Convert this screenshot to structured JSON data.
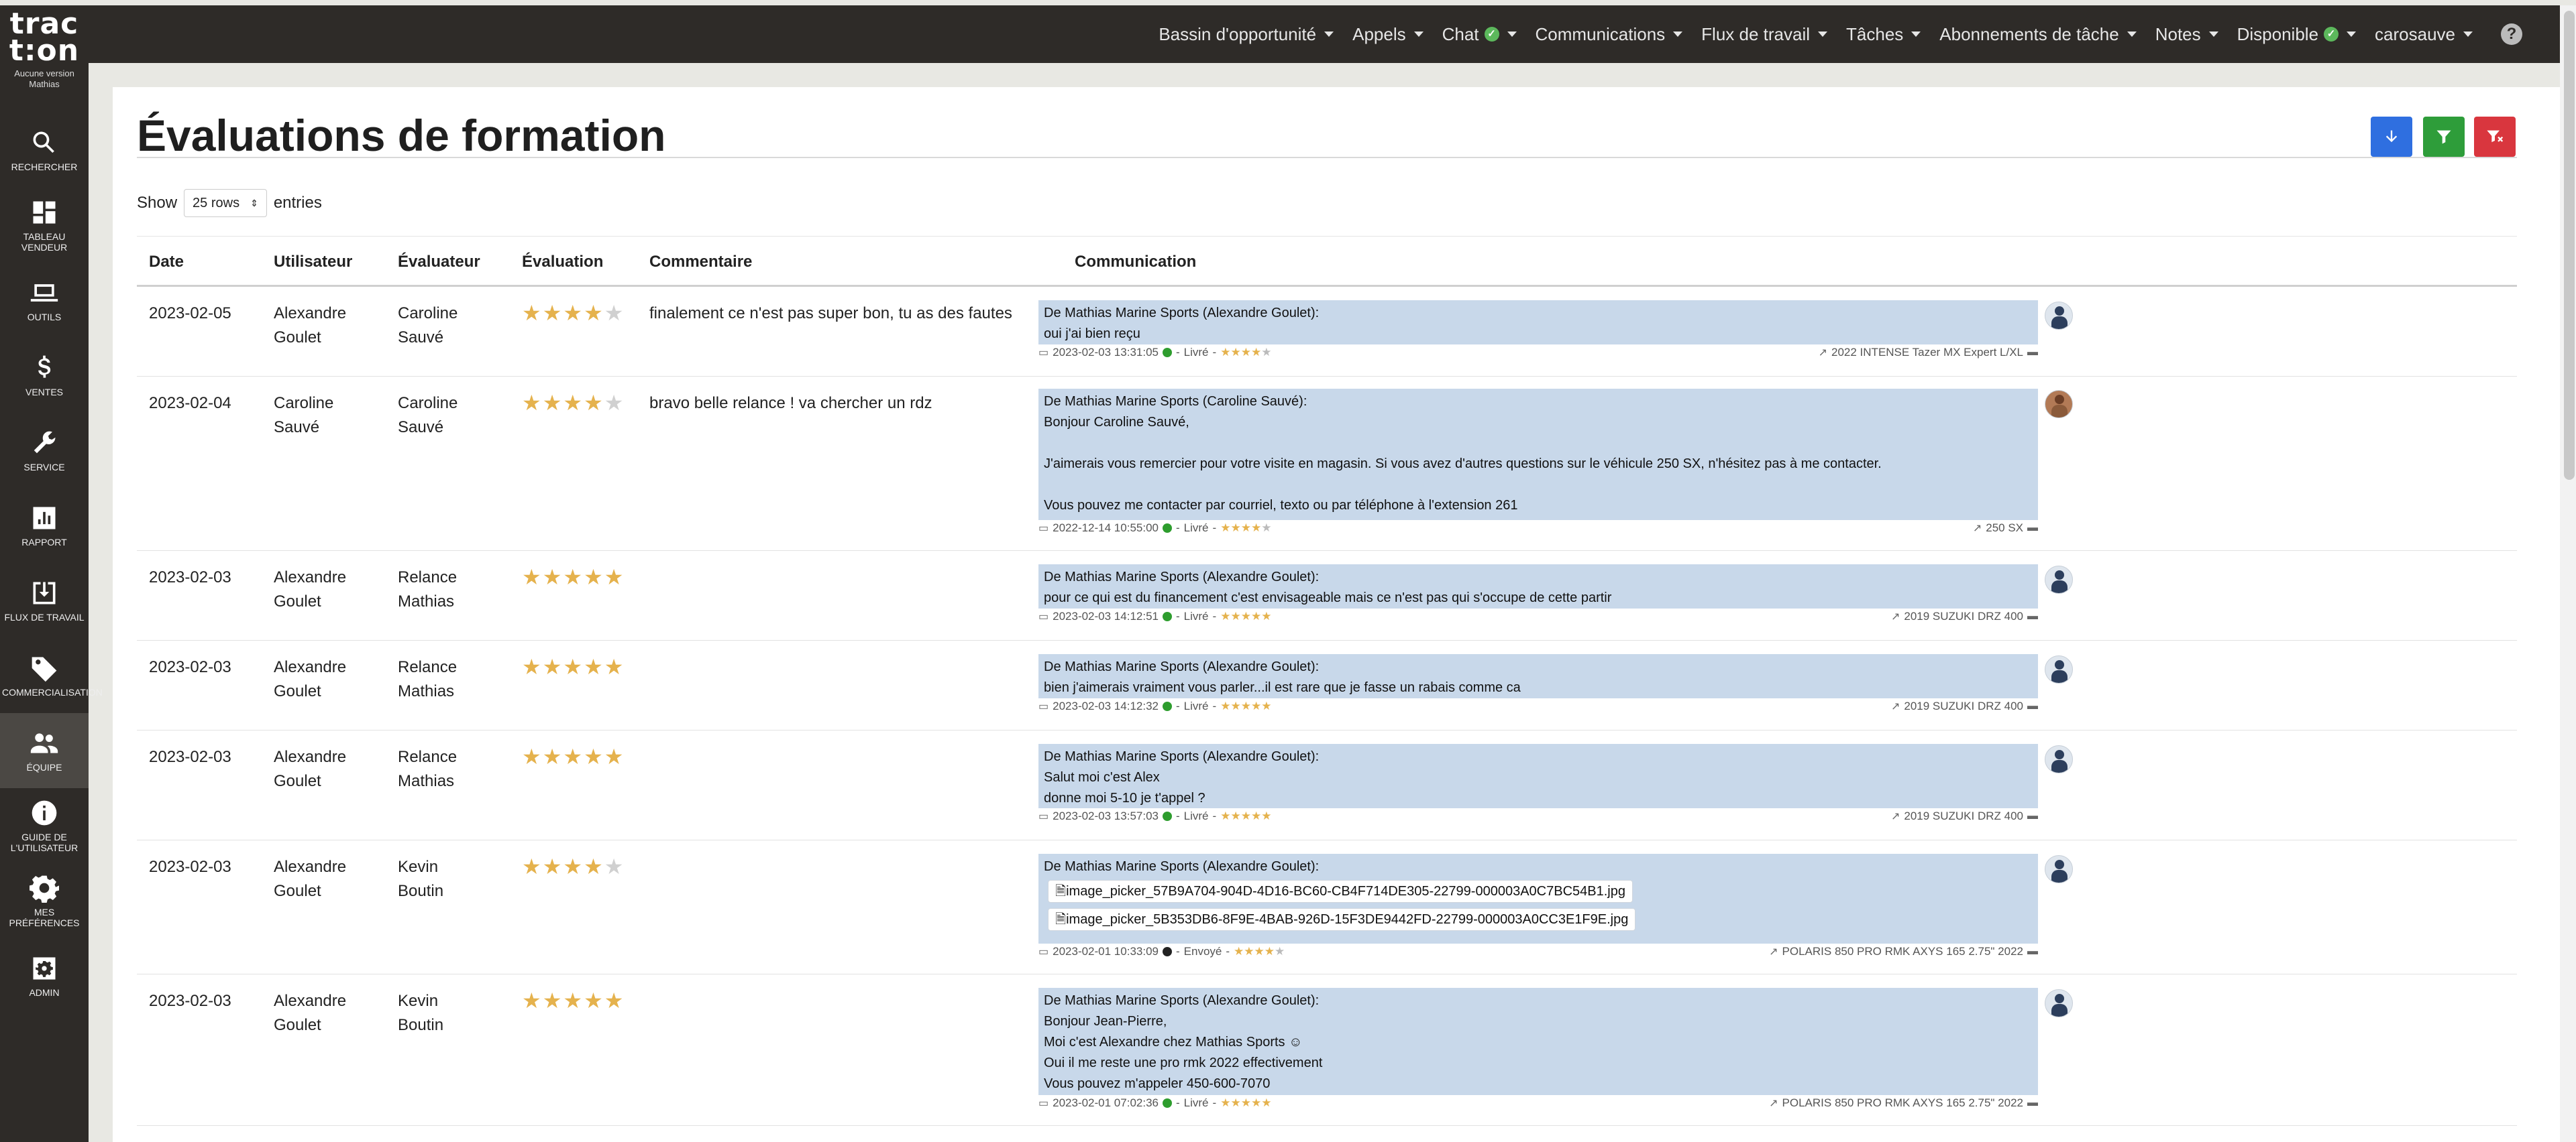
{
  "app": {
    "logo_line1": "trac",
    "logo_line2": "t:on",
    "version_line1": "Aucune version",
    "version_line2": "Mathias"
  },
  "sidebar": {
    "items": [
      {
        "label": "RECHERCHER",
        "icon": "search-icon"
      },
      {
        "label": "TABLEAU VENDEUR",
        "icon": "dashboard-icon"
      },
      {
        "label": "OUTILS",
        "icon": "laptop-icon"
      },
      {
        "label": "VENTES",
        "icon": "dollar-icon"
      },
      {
        "label": "SERVICE",
        "icon": "wrench-icon"
      },
      {
        "label": "RAPPORT",
        "icon": "bar-chart-icon"
      },
      {
        "label": "FLUX DE TRAVAIL",
        "icon": "download-box-icon"
      },
      {
        "label": "COMMERCIALISATION",
        "icon": "tag-icon"
      },
      {
        "label": "ÉQUIPE",
        "icon": "people-icon"
      },
      {
        "label": "GUIDE DE L'UTILISATEUR",
        "icon": "info-icon"
      },
      {
        "label": "MES PRÉFÉRENCES",
        "icon": "gear-icon"
      },
      {
        "label": "ADMIN",
        "icon": "admin-gear-icon"
      }
    ],
    "active_index": 8
  },
  "topnav": {
    "items": [
      "Bassin d'opportunité",
      "Appels",
      "Chat",
      "Communications",
      "Flux de travail",
      "Tâches",
      "Abonnements de tâche",
      "Notes",
      "Disponible",
      "carosauve"
    ],
    "check": "✓",
    "help": "?"
  },
  "page": {
    "title": "Évaluations de formation",
    "show_label": "Show",
    "rows_select": "25 rows",
    "entries_label": "entries",
    "buttons": {
      "download_color": "#2f6fe0",
      "filter_color": "#2e9d3a",
      "clear_filter_color": "#d9363e"
    }
  },
  "table": {
    "headers": {
      "date": "Date",
      "user": "Utilisateur",
      "evaluator": "Évaluateur",
      "rating": "Évaluation",
      "comment": "Commentaire",
      "communication": "Communication"
    },
    "rows": [
      {
        "date": "2023-02-05",
        "user": "Alexandre Goulet",
        "evaluator": "Caroline Sauvé",
        "rating": 4,
        "comment": "finalement ce n'est pas super bon, tu as des fautes",
        "comm_lines": [
          "De Mathias Marine Sports (Alexandre Goulet):",
          "oui j'ai bien reçu"
        ],
        "meta_time": "2023-02-03 13:31:05",
        "meta_status": "Livré",
        "meta_stars": 4,
        "meta_vehicle": "2022 INTENSE Tazer MX Expert L/XL"
      },
      {
        "date": "2023-02-04",
        "user": "Caroline Sauvé",
        "evaluator": "Caroline Sauvé",
        "rating": 4,
        "comment": "bravo belle relance ! va chercher un rdz",
        "comm_lines": [
          "De Mathias Marine Sports (Caroline Sauvé):",
          "Bonjour Caroline Sauvé,",
          "",
          "J'aimerais vous remercier pour votre visite en magasin. Si vous avez d'autres questions sur le véhicule 250 SX, n'hésitez pas à me contacter.",
          "",
          "Vous pouvez me contacter par courriel, texto ou par téléphone à l'extension 261"
        ],
        "meta_time": "2022-12-14 10:55:00",
        "meta_status": "Livré",
        "meta_stars": 4,
        "meta_vehicle": "250 SX"
      },
      {
        "date": "2023-02-03",
        "user": "Alexandre Goulet",
        "evaluator": "Relance Mathias",
        "rating": 5,
        "comment": "",
        "comm_lines": [
          "De Mathias Marine Sports (Alexandre Goulet):",
          "pour ce qui est du financement c'est envisageable mais ce n'est pas qui s'occupe de cette partir"
        ],
        "meta_time": "2023-02-03 14:12:51",
        "meta_status": "Livré",
        "meta_stars": 5,
        "meta_vehicle": "2019 SUZUKI DRZ 400"
      },
      {
        "date": "2023-02-03",
        "user": "Alexandre Goulet",
        "evaluator": "Relance Mathias",
        "rating": 5,
        "comment": "",
        "comm_lines": [
          "De Mathias Marine Sports (Alexandre Goulet):",
          "bien j'aimerais vraiment vous parler...il est rare que je fasse un rabais comme ca"
        ],
        "meta_time": "2023-02-03 14:12:32",
        "meta_status": "Livré",
        "meta_stars": 5,
        "meta_vehicle": "2019 SUZUKI DRZ 400"
      },
      {
        "date": "2023-02-03",
        "user": "Alexandre Goulet",
        "evaluator": "Relance Mathias",
        "rating": 5,
        "comment": "",
        "comm_lines": [
          "De Mathias Marine Sports (Alexandre Goulet):",
          "Salut moi c'est Alex",
          "donne moi 5-10 je t'appel ?"
        ],
        "meta_time": "2023-02-03 13:57:03",
        "meta_status": "Livré",
        "meta_stars": 5,
        "meta_vehicle": "2019 SUZUKI DRZ 400"
      },
      {
        "date": "2023-02-03",
        "user": "Alexandre Goulet",
        "evaluator": "Kevin Boutin",
        "rating": 4,
        "comment": "",
        "comm_lines": [
          "De Mathias Marine Sports (Alexandre Goulet):"
        ],
        "attachments": [
          "image_picker_57B9A704-904D-4D16-BC60-CB4F714DE305-22799-000003A0C7BC54B1.jpg",
          "image_picker_5B353DB6-8F9E-4BAB-926D-15F3DE9442FD-22799-000003A0CC3E1F9E.jpg"
        ],
        "meta_time": "2023-02-01 10:33:09",
        "meta_status": "Envoyé",
        "meta_stars": 4,
        "meta_vehicle": "POLARIS 850 PRO RMK AXYS 165 2.75\" 2022"
      },
      {
        "date": "2023-02-03",
        "user": "Alexandre Goulet",
        "evaluator": "Kevin Boutin",
        "rating": 5,
        "comment": "",
        "comm_lines": [
          "De Mathias Marine Sports (Alexandre Goulet):",
          "Bonjour Jean-Pierre,",
          "Moi c'est Alexandre chez Mathias Sports ☺",
          "Oui il me reste une pro rmk 2022 effectivement",
          "Vous pouvez m'appeler 450-600-7070"
        ],
        "meta_time": "2023-02-01 07:02:36",
        "meta_status": "Livré",
        "meta_stars": 5,
        "meta_vehicle": "POLARIS 850 PRO RMK AXYS 165 2.75\" 2022"
      }
    ]
  }
}
